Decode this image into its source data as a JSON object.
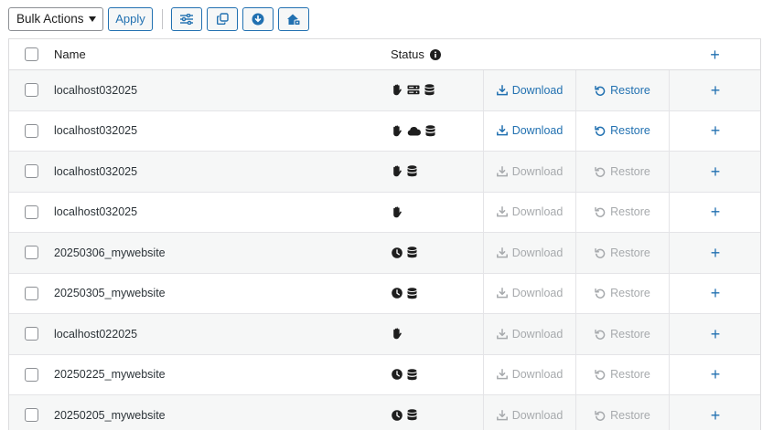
{
  "toolbar": {
    "bulk_select_value": "Bulk Actions",
    "apply_label": "Apply",
    "icons": [
      "sliders-icon",
      "copy-icon",
      "download-circle-icon",
      "home-lock-icon"
    ]
  },
  "table": {
    "headers": {
      "name": "Name",
      "status": "Status"
    },
    "rows": [
      {
        "name": "localhost032025",
        "status_icons": [
          "hand",
          "server",
          "database"
        ],
        "actions_enabled": true
      },
      {
        "name": "localhost032025",
        "status_icons": [
          "hand",
          "cloud",
          "database"
        ],
        "actions_enabled": true
      },
      {
        "name": "localhost032025",
        "status_icons": [
          "hand",
          "database"
        ],
        "actions_enabled": false
      },
      {
        "name": "localhost032025",
        "status_icons": [
          "hand"
        ],
        "actions_enabled": false
      },
      {
        "name": "20250306_mywebsite",
        "status_icons": [
          "clock",
          "database"
        ],
        "actions_enabled": false
      },
      {
        "name": "20250305_mywebsite",
        "status_icons": [
          "clock",
          "database"
        ],
        "actions_enabled": false
      },
      {
        "name": "localhost022025",
        "status_icons": [
          "hand"
        ],
        "actions_enabled": false
      },
      {
        "name": "20250225_mywebsite",
        "status_icons": [
          "clock",
          "database"
        ],
        "actions_enabled": false
      },
      {
        "name": "20250205_mywebsite",
        "status_icons": [
          "clock",
          "database"
        ],
        "actions_enabled": false
      }
    ],
    "download_label": "Download",
    "restore_label": "Restore",
    "more_symbol": "+"
  },
  "colors": {
    "accent": "#2271b1",
    "disabled": "#a7aaad",
    "row_alt": "#f6f7f7"
  }
}
